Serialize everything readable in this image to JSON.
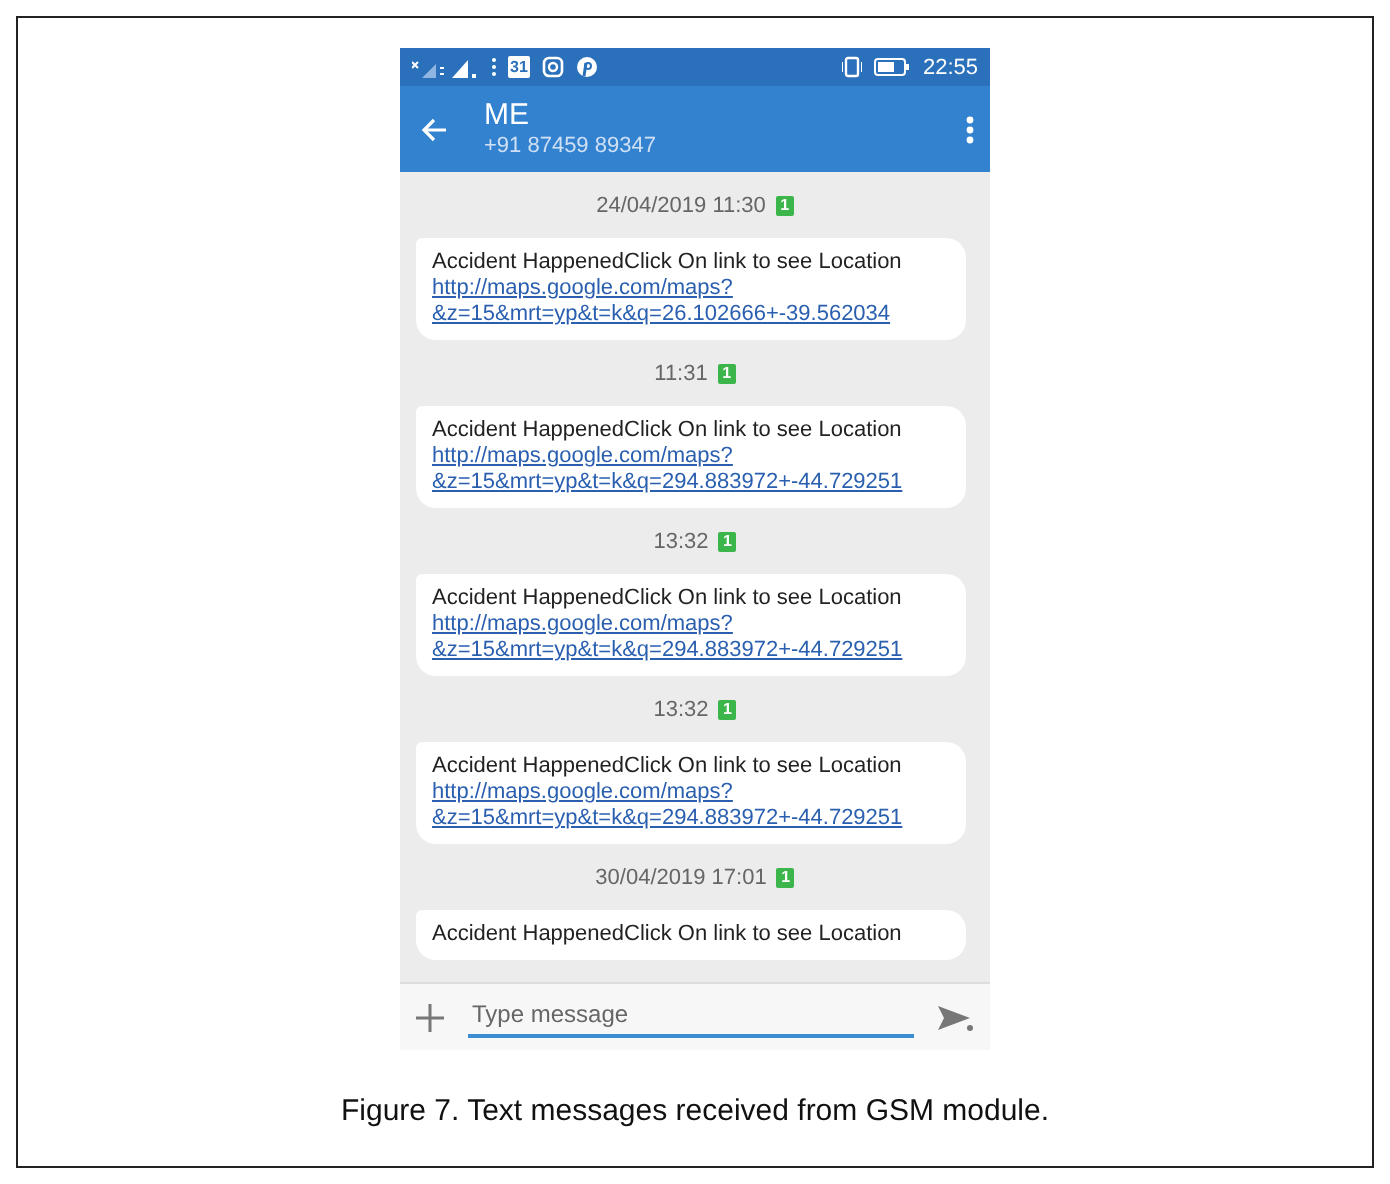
{
  "status_bar": {
    "calendar_day": "31",
    "time": "22:55"
  },
  "app_bar": {
    "title": "ME",
    "subtitle": "+91 87459 89347"
  },
  "messages": [
    {
      "timestamp": "24/04/2019 11:30",
      "sim": "1",
      "text": "Accident HappenedClick On link to see Location",
      "link": [
        "http://maps.google.com/maps?",
        "&z=15&mrt=yp&t=k&q=26.102666+-39.562034"
      ]
    },
    {
      "timestamp": "11:31",
      "sim": "1",
      "text": "Accident HappenedClick On link to see Location",
      "link": [
        "http://maps.google.com/maps?",
        "&z=15&mrt=yp&t=k&q=294.883972+-44.729251"
      ]
    },
    {
      "timestamp": "13:32",
      "sim": "1",
      "text": "Accident HappenedClick On link to see Location",
      "link": [
        "http://maps.google.com/maps?",
        "&z=15&mrt=yp&t=k&q=294.883972+-44.729251"
      ]
    },
    {
      "timestamp": "13:32",
      "sim": "1",
      "text": "Accident HappenedClick On link to see Location",
      "link": [
        "http://maps.google.com/maps?",
        "&z=15&mrt=yp&t=k&q=294.883972+-44.729251"
      ]
    },
    {
      "timestamp": "30/04/2019 17:01",
      "sim": "1",
      "text": "Accident HappenedClick On link to see Location"
    }
  ],
  "composer": {
    "placeholder": "Type message"
  },
  "caption": "Figure 7. Text messages received from GSM module."
}
